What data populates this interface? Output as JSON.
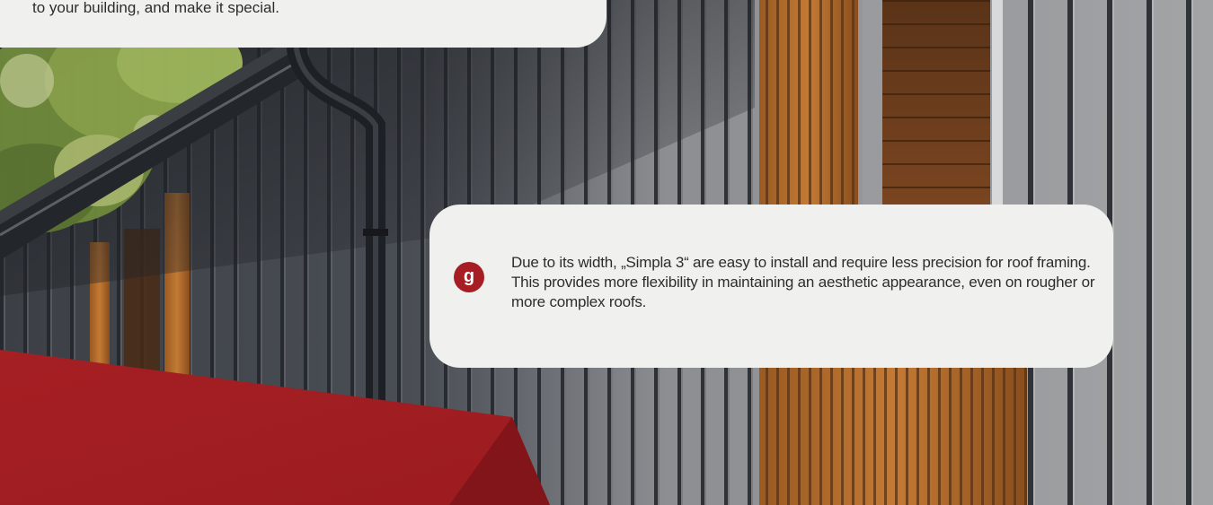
{
  "callout_top": {
    "text": "to your building, and make it special."
  },
  "callout_main": {
    "bullet_letter": "g",
    "text": "Due to its width, „Simpla 3“ are easy to install and require less precision for roof framing. This provides more flexibility in maintaining an aesthetic appearance, even on rougher or more complex roofs."
  },
  "colors": {
    "accent_red": "#a61e24",
    "card_bg": "#f0f1ef",
    "text": "#2d2d2d"
  },
  "icons": {
    "bullet": "letter-badge-icon"
  }
}
